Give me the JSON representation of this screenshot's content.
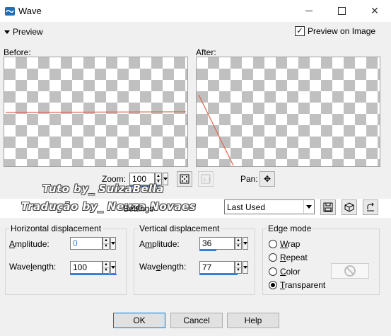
{
  "window": {
    "title": "Wave"
  },
  "preview": {
    "toggle_label": "Preview",
    "checkbox_label": "Preview on Image",
    "checkbox_checked": true
  },
  "panes": {
    "before_label": "Before:",
    "after_label": "After:"
  },
  "zoom": {
    "label": "Zoom:",
    "value": "100"
  },
  "pan": {
    "label": "Pan:"
  },
  "watermark": {
    "line1": "Tuto by_ SuizaBella",
    "line2": "Tradução by_ Neuza Novaes"
  },
  "settings": {
    "label": "Settings",
    "selected": "Last Used"
  },
  "horizontal": {
    "title": "Horizontal displacement",
    "amplitude_label": "Amplitude:",
    "amplitude": "0",
    "wavelength_label": "Wavelength:",
    "wavelength": "100"
  },
  "vertical": {
    "title": "Vertical displacement",
    "amplitude_label": "Amplitude:",
    "amplitude": "36",
    "wavelength_label": "Wavelength:",
    "wavelength": "77"
  },
  "edge_mode": {
    "title": "Edge mode",
    "options": [
      "Wrap",
      "Repeat",
      "Color",
      "Transparent"
    ],
    "selected": "Transparent"
  },
  "buttons": {
    "ok": "OK",
    "cancel": "Cancel",
    "help": "Help"
  },
  "colors": {
    "accent": "#0078d7",
    "line": "#d9654a",
    "checker": "#c0c0c0"
  },
  "icons": [
    "wave-app-icon",
    "minimize-icon",
    "maximize-icon",
    "close-icon",
    "zoom-fit-icon",
    "zoom-actual-icon",
    "pan-move-icon",
    "save-preset-icon",
    "reset-preset-icon",
    "copy-preset-icon",
    "no-color-icon"
  ]
}
